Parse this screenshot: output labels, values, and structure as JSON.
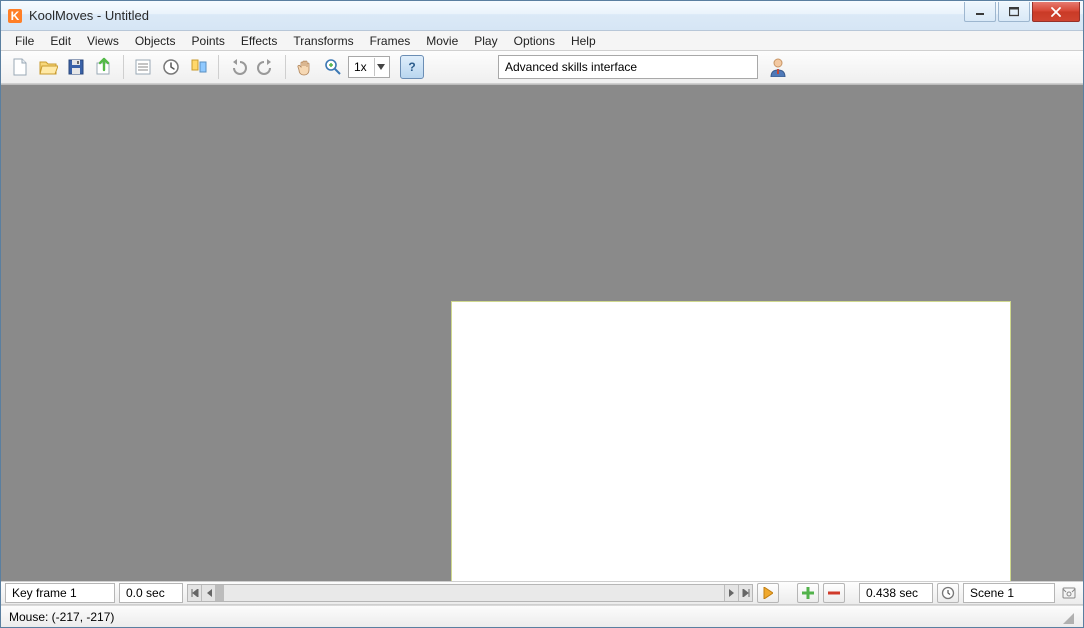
{
  "titlebar": {
    "title": "KoolMoves - Untitled"
  },
  "menu": {
    "file": "File",
    "edit": "Edit",
    "views": "Views",
    "objects": "Objects",
    "points": "Points",
    "effects": "Effects",
    "transforms": "Transforms",
    "frames": "Frames",
    "movie": "Movie",
    "play": "Play",
    "options": "Options",
    "help": "Help"
  },
  "toolbar": {
    "zoom_value": "1x",
    "help_label": "?",
    "search_value": "Advanced skills interface"
  },
  "bottom": {
    "keyframe": "Key frame 1",
    "time": "0.0 sec",
    "duration": "0.438 sec",
    "scene": "Scene 1"
  },
  "status": {
    "mouse": "Mouse: (-217, -217)"
  }
}
